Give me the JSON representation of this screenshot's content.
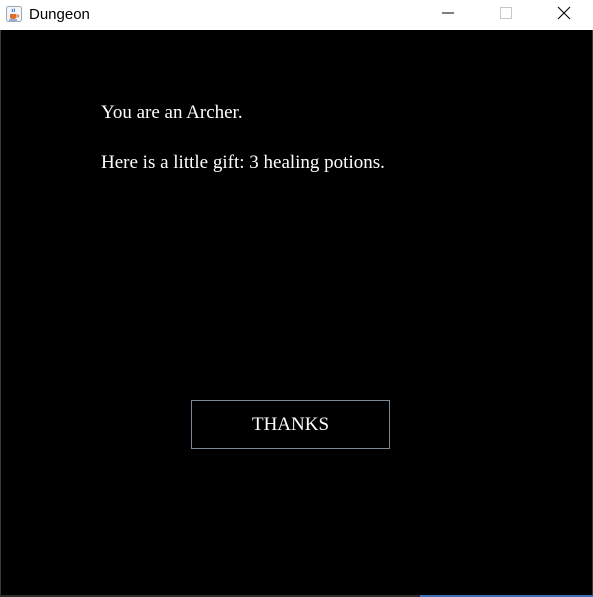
{
  "window": {
    "title": "Dungeon",
    "app_icon": "java-cup-icon",
    "controls": {
      "minimize_icon": "minimize-icon",
      "maximize_icon": "maximize-icon",
      "close_icon": "close-icon"
    }
  },
  "main": {
    "background": "#000000",
    "text_color": "#ffffff",
    "line_1": "You are an Archer.",
    "line_2": "Here is a little gift: 3 healing potions.",
    "button_label": "THANKS",
    "button_border_color": "#7a8a9a"
  }
}
